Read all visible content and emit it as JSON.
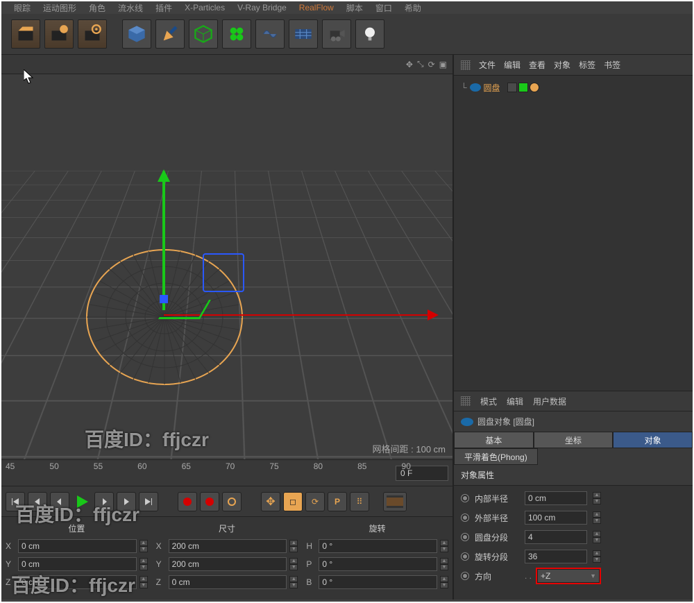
{
  "menubar": [
    "眼踪",
    "运动图形",
    "角色",
    "流水线",
    "插件",
    "X-Particles",
    "V-Ray Bridge",
    "RealFlow",
    "脚本",
    "窗口",
    "希助"
  ],
  "viewport": {
    "grid_label": "网格间距 : 100 cm"
  },
  "timeline": {
    "marks": [
      "45",
      "50",
      "55",
      "60",
      "65",
      "70",
      "75",
      "80",
      "85",
      "90"
    ],
    "frame": "0 F"
  },
  "coords": {
    "headers": [
      "位置",
      "尺寸",
      "旋转"
    ],
    "rows": [
      {
        "a": "X",
        "av": "0 cm",
        "b": "X",
        "bv": "200 cm",
        "c": "H",
        "cv": "0 °"
      },
      {
        "a": "Y",
        "av": "0 cm",
        "b": "Y",
        "bv": "200 cm",
        "c": "P",
        "cv": "0 °"
      },
      {
        "a": "Z",
        "av": "0 cm",
        "b": "Z",
        "bv": "0 cm",
        "c": "B",
        "cv": "0 °"
      }
    ]
  },
  "objmgr": {
    "menus": [
      "文件",
      "编辑",
      "查看",
      "对象",
      "标签",
      "书签"
    ],
    "items": [
      {
        "name": "圆盘"
      }
    ]
  },
  "attrmgr": {
    "menus": [
      "模式",
      "编辑",
      "用户数据"
    ],
    "title": "圆盘对象 [圆盘]",
    "tabs1": [
      "基本",
      "坐标",
      "对象"
    ],
    "tabs2": [
      "平滑着色(Phong)"
    ],
    "section": "对象属性",
    "props": {
      "inner_radius": {
        "label": "内部半径",
        "value": "0 cm"
      },
      "outer_radius": {
        "label": "外部半径",
        "value": "100 cm"
      },
      "disc_segments": {
        "label": "圆盘分段",
        "value": "4"
      },
      "rot_segments": {
        "label": "旋转分段",
        "value": "36"
      },
      "direction": {
        "label": "方向",
        "value": "+Z"
      }
    }
  },
  "watermark": "百度ID：ffjczr"
}
